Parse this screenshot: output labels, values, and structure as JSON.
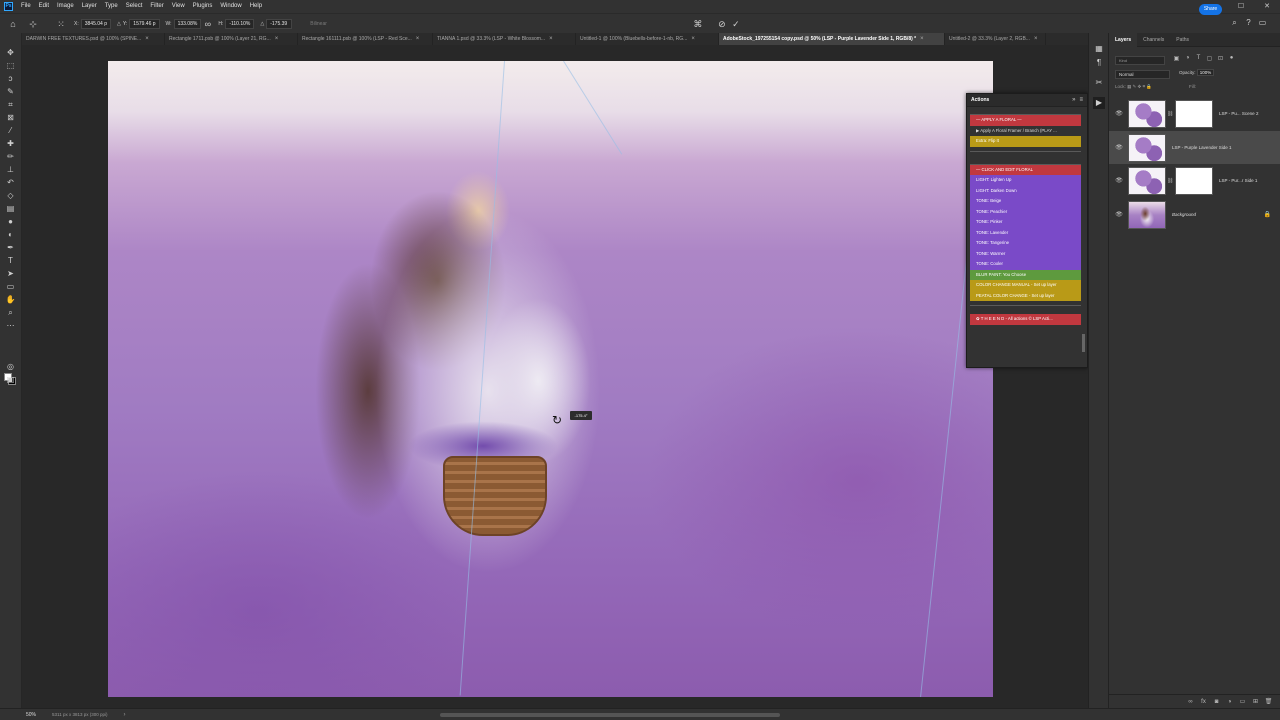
{
  "app": {
    "logo": "Ps",
    "menu": [
      "File",
      "Edit",
      "Image",
      "Layer",
      "Type",
      "Select",
      "Filter",
      "View",
      "Plugins",
      "Window",
      "Help"
    ],
    "window_controls": [
      "—",
      "☐",
      "✕"
    ]
  },
  "options_bar": {
    "x_label": "X:",
    "x_value": "3845.04 p",
    "y_label": "Y:",
    "y_value": "1579.46 p",
    "w_label": "W:",
    "w_value": "133.08%",
    "h_label": "H:",
    "h_value": "-110.10%",
    "angle_label": "△",
    "angle_value": "-175.39",
    "interpolation": "Bilinear",
    "share_label": "Share"
  },
  "tabs": [
    {
      "name": "DARWIN FREE TEXTURES.psd @ 100% (SPINE...",
      "active": false
    },
    {
      "name": "Rectangle 1711.psb @ 100% (Layer 21, RG...",
      "active": false
    },
    {
      "name": "Rectangle 161111.psb @ 100% (LSP - Red Sce...",
      "active": false
    },
    {
      "name": "TIANNA 1.psd @ 33.3% (LSP - White Blossom...",
      "active": false
    },
    {
      "name": "Untitled-1 @ 100% (Bluebells-before-1-nb, RG...",
      "active": false
    },
    {
      "name": "AdobeStock_197255154 copy.psd @ 50% (LSP - Purple Lavender Side 1, RGB/8) *",
      "active": true
    },
    {
      "name": "Untitled-2 @ 33.3% (Layer 2, RGB...",
      "active": false
    }
  ],
  "canvas": {
    "rotate_readout": "-175.4°"
  },
  "actions_panel": {
    "title": "Actions",
    "rows": [
      {
        "text": "",
        "style": "sep"
      },
      {
        "text": "— APPLY A FLORAL —",
        "style": "red"
      },
      {
        "text": "▶ Apply A Floral Framer / Branch (PLAY ...",
        "style": "plain"
      },
      {
        "text": "Extra: Flip It",
        "style": "gold"
      },
      {
        "text": "",
        "style": "sep"
      },
      {
        "text": "",
        "style": "gap"
      },
      {
        "text": "",
        "style": "sep"
      },
      {
        "text": "— CLICK AND EDIT FLORAL",
        "style": "red"
      },
      {
        "text": "LIGHT: Lighten Up",
        "style": "purple"
      },
      {
        "text": "LIGHT: Darken Down",
        "style": "purple"
      },
      {
        "text": "TONE: Beige",
        "style": "purple"
      },
      {
        "text": "TONE: Peachier",
        "style": "purple"
      },
      {
        "text": "TONE: Pinker",
        "style": "purple"
      },
      {
        "text": "TONE: Lavender",
        "style": "purple"
      },
      {
        "text": "TONE: Tangerine",
        "style": "purple"
      },
      {
        "text": "TONE: Warmer",
        "style": "purple"
      },
      {
        "text": "TONE: Cooler",
        "style": "purple"
      },
      {
        "text": "BLUR PAINT: You Choose",
        "style": "green"
      },
      {
        "text": "COLOR CHANGE MANUAL - Set up layer",
        "style": "gold"
      },
      {
        "text": "PEATAL COLOR CHANGE - Set up layer",
        "style": "gold"
      },
      {
        "text": "",
        "style": "sep"
      },
      {
        "text": "",
        "style": "gap"
      },
      {
        "text": "✿ T H E  E N D - All actions © LSP Acti...",
        "style": "red"
      }
    ]
  },
  "layers_panel": {
    "tabs": [
      "Layers",
      "Channels",
      "Paths"
    ],
    "search_placeholder": "Kind",
    "blend_mode": "Normal",
    "opacity_label": "Opacity:",
    "opacity_value": "100%",
    "lock_label": "Lock:",
    "fill_label": "Fill:",
    "layers": [
      {
        "name": "LSP - Pu... Scene 2",
        "thumb": "art",
        "mask": true,
        "selected": false,
        "italic": false,
        "locked": false
      },
      {
        "name": "LSP - Purple Lavender Side 1",
        "thumb": "art",
        "mask": false,
        "selected": true,
        "italic": false,
        "locked": false
      },
      {
        "name": "LSP - Pur...r Side 1",
        "thumb": "art",
        "mask": true,
        "selected": false,
        "italic": false,
        "locked": false
      },
      {
        "name": "Background",
        "thumb": "bg",
        "mask": false,
        "selected": false,
        "italic": true,
        "locked": true
      }
    ]
  },
  "status_bar": {
    "zoom": "50%",
    "doc_size": "5311 px x 3813 px (300 ppi)",
    "arrow": "›"
  }
}
